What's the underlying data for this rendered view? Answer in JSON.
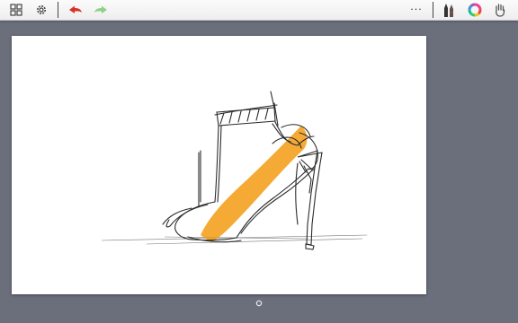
{
  "toolbar": {
    "left_icons": [
      "gallery-grid-icon",
      "settings-gear-icon"
    ],
    "history_icons": [
      "undo-icon",
      "redo-icon"
    ],
    "right_icons": [
      "more-menu-icon",
      "brush-library-icon",
      "color-wheel-icon",
      "pan-hand-icon"
    ],
    "more_label": "···",
    "colors": {
      "undo": "#d8322a",
      "redo": "#8fd08a",
      "bar_background": "#f6f6f6"
    }
  },
  "workspace": {
    "background_color": "#6b6e7b",
    "canvas_color": "#ffffff"
  },
  "sketch": {
    "subject": "high-heel-boot-sketch-icon",
    "stroke_color": "#2b2b2b",
    "marker_color": "#f39c12"
  },
  "pagination": {
    "current_page": 1
  }
}
